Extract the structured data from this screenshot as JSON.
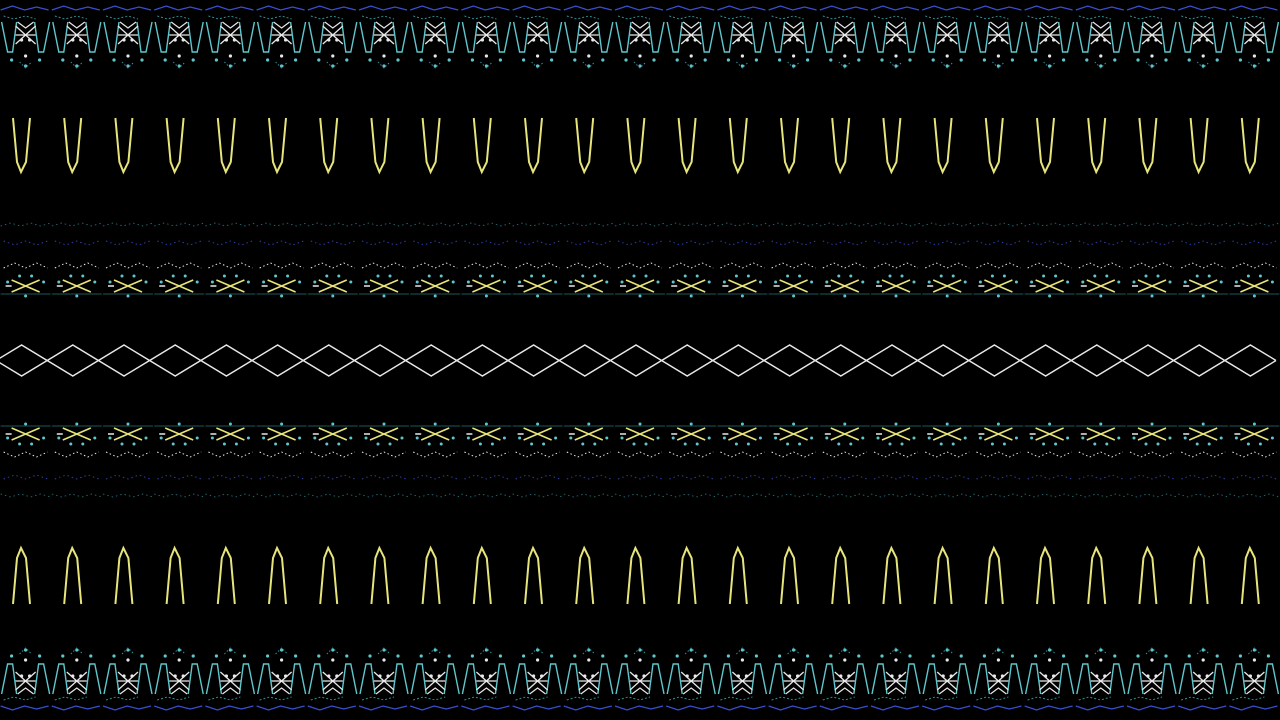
{
  "scene": {
    "description_free": true,
    "background": "#000000",
    "colors": {
      "yellow": "#e6e47a",
      "white": "#e8e8e8",
      "cyan": "#5fc7cc",
      "teal": "#2f8f9a",
      "blue": "#3a4fd0"
    },
    "bands": [
      {
        "kind": "ornate",
        "mirrored": false
      },
      {
        "kind": "v-spikes",
        "direction": "down"
      },
      {
        "kind": "dotted-x",
        "mirrored": false
      },
      {
        "kind": "zigzag-chain"
      },
      {
        "kind": "dotted-x",
        "mirrored": true
      },
      {
        "kind": "v-spikes",
        "direction": "up"
      },
      {
        "kind": "ornate",
        "mirrored": true
      }
    ]
  }
}
